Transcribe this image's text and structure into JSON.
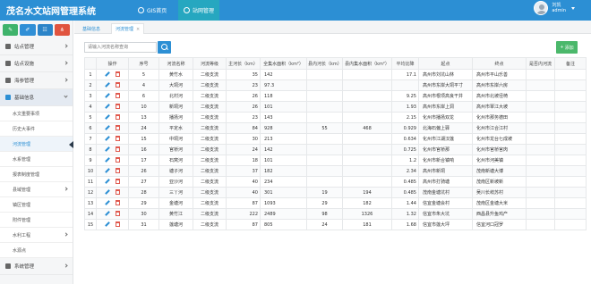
{
  "app": {
    "title": "茂名水文站网管理系统"
  },
  "nav": {
    "gis_label": "GIS首页",
    "station_label": "站网管理"
  },
  "user": {
    "name": "刘凯",
    "role": "admin"
  },
  "colors": {
    "header": "#2c8fd4",
    "active_tab": "#26a7c0",
    "add_button": "#4bb86b",
    "delete_icon": "#e05a4f"
  },
  "quick_buttons": [
    {
      "icon": "edit-icon",
      "color": "#3fb36b"
    },
    {
      "icon": "pencil-icon",
      "color": "#2f8fd6"
    },
    {
      "icon": "sitemap-icon",
      "color": "#2b84c8"
    },
    {
      "icon": "share-icon",
      "color": "#e0543f"
    }
  ],
  "sidebar": {
    "items": [
      {
        "label": "站点管理",
        "icon": "list-icon"
      },
      {
        "label": "站点设施",
        "icon": "gear-icon"
      },
      {
        "label": "海参管理",
        "icon": "truck-icon"
      }
    ],
    "open_section": {
      "label": "基础信息",
      "icon": "book-icon"
    },
    "subs": [
      {
        "label": "水文重要事项"
      },
      {
        "label": "历史大事件"
      },
      {
        "label": "河流管理"
      },
      {
        "label": "水系管理"
      },
      {
        "label": "报表制度管理"
      },
      {
        "label": "县域管理"
      },
      {
        "label": "镇区管理"
      },
      {
        "label": "附件管理"
      },
      {
        "label": "水利工程"
      },
      {
        "label": "水源点"
      }
    ],
    "bottom": {
      "label": "系统管理",
      "icon": "cog-icon"
    }
  },
  "tabs": {
    "home": "基础信息",
    "current": "河流管理"
  },
  "toolbar": {
    "search_placeholder": "请输入河流名称查询",
    "add_label": "添加"
  },
  "table": {
    "headers": [
      "",
      "操作",
      "序号",
      "河流名称",
      "河流等级",
      "主河长（km）",
      "全集水面积（km²）",
      "县内河长（km）",
      "县内集水面积（km²）",
      "平均比降",
      "起点",
      "终点",
      "是否内河流",
      "备注"
    ],
    "rows": [
      [
        "1",
        "5",
        "黄竹水",
        "二级支流",
        "35",
        "142",
        "",
        "",
        "17.1",
        "高州市刘坑山林",
        "高州市平山乐善",
        "",
        ""
      ],
      [
        "2",
        "4",
        "大垌河",
        "二级支流",
        "23",
        "97.3",
        "",
        "",
        "",
        "高州市东岸大垌平寸",
        "高州市东岸六房",
        "",
        ""
      ],
      [
        "3",
        "6",
        "北村河",
        "二级支流",
        "26",
        "118",
        "",
        "",
        "9.25",
        "高州市根项高良干井",
        "高州市北坡径椅",
        "",
        ""
      ],
      [
        "4",
        "10",
        "新垌河",
        "二级支流",
        "26",
        "101",
        "",
        "",
        "1.93",
        "高州市东岸上洞",
        "高州市覃江大坡",
        "",
        ""
      ],
      [
        "5",
        "13",
        "播扬河",
        "二级支流",
        "23",
        "143",
        "",
        "",
        "2.15",
        "化州市播扬双龙",
        "化州市那务德田",
        "",
        ""
      ],
      [
        "6",
        "24",
        "平定水",
        "二级支流",
        "84",
        "928",
        "55",
        "468",
        "0.929",
        "北海石偏上驿",
        "化州市江合江村",
        "",
        ""
      ],
      [
        "7",
        "15",
        "中垌河",
        "二级支流",
        "30",
        "213",
        "",
        "",
        "0.634",
        "化州市江湖汉莲",
        "化州市龙台七成坡",
        "",
        ""
      ],
      [
        "8",
        "16",
        "官桥河",
        "二级支流",
        "24",
        "142",
        "",
        "",
        "0.725",
        "化州市官桥那",
        "化州市官桥官肉",
        "",
        ""
      ],
      [
        "9",
        "17",
        "石窝河",
        "二级支流",
        "18",
        "101",
        "",
        "",
        "1.2",
        "化州市新合镇响",
        "化州市河美镇",
        "",
        ""
      ],
      [
        "10",
        "26",
        "塘子河",
        "二级支流",
        "37",
        "182",
        "",
        "",
        "2.34",
        "高州市新垌",
        "茂南新塘大博",
        "",
        ""
      ],
      [
        "11",
        "27",
        "亚沙河",
        "二级支流",
        "40",
        "234",
        "",
        "",
        "0.485",
        "高州市打骑塘",
        "茂南区新坡新",
        "",
        ""
      ],
      [
        "12",
        "28",
        "三丫河",
        "二级支流",
        "40",
        "301",
        "19",
        "194",
        "0.485",
        "茂南金塘坑村",
        "吴川长岐苏村",
        "",
        ""
      ],
      [
        "13",
        "29",
        "金塘河",
        "二级支流",
        "87",
        "1093",
        "29",
        "182",
        "1.44",
        "信宜金塘会村",
        "茂南区金塘大米",
        "",
        ""
      ],
      [
        "14",
        "30",
        "黄竹江",
        "二级支流",
        "222",
        "2489",
        "98",
        "1326",
        "1.32",
        "信宜市朱大坑",
        "西昌县升鱼鸡产",
        "",
        ""
      ],
      [
        "15",
        "31",
        "莲塘河",
        "二级支流",
        "87",
        "805",
        "24",
        "181",
        "1.68",
        "信宜市莲大坪",
        "信宜河口冠罗",
        "",
        ""
      ]
    ]
  }
}
